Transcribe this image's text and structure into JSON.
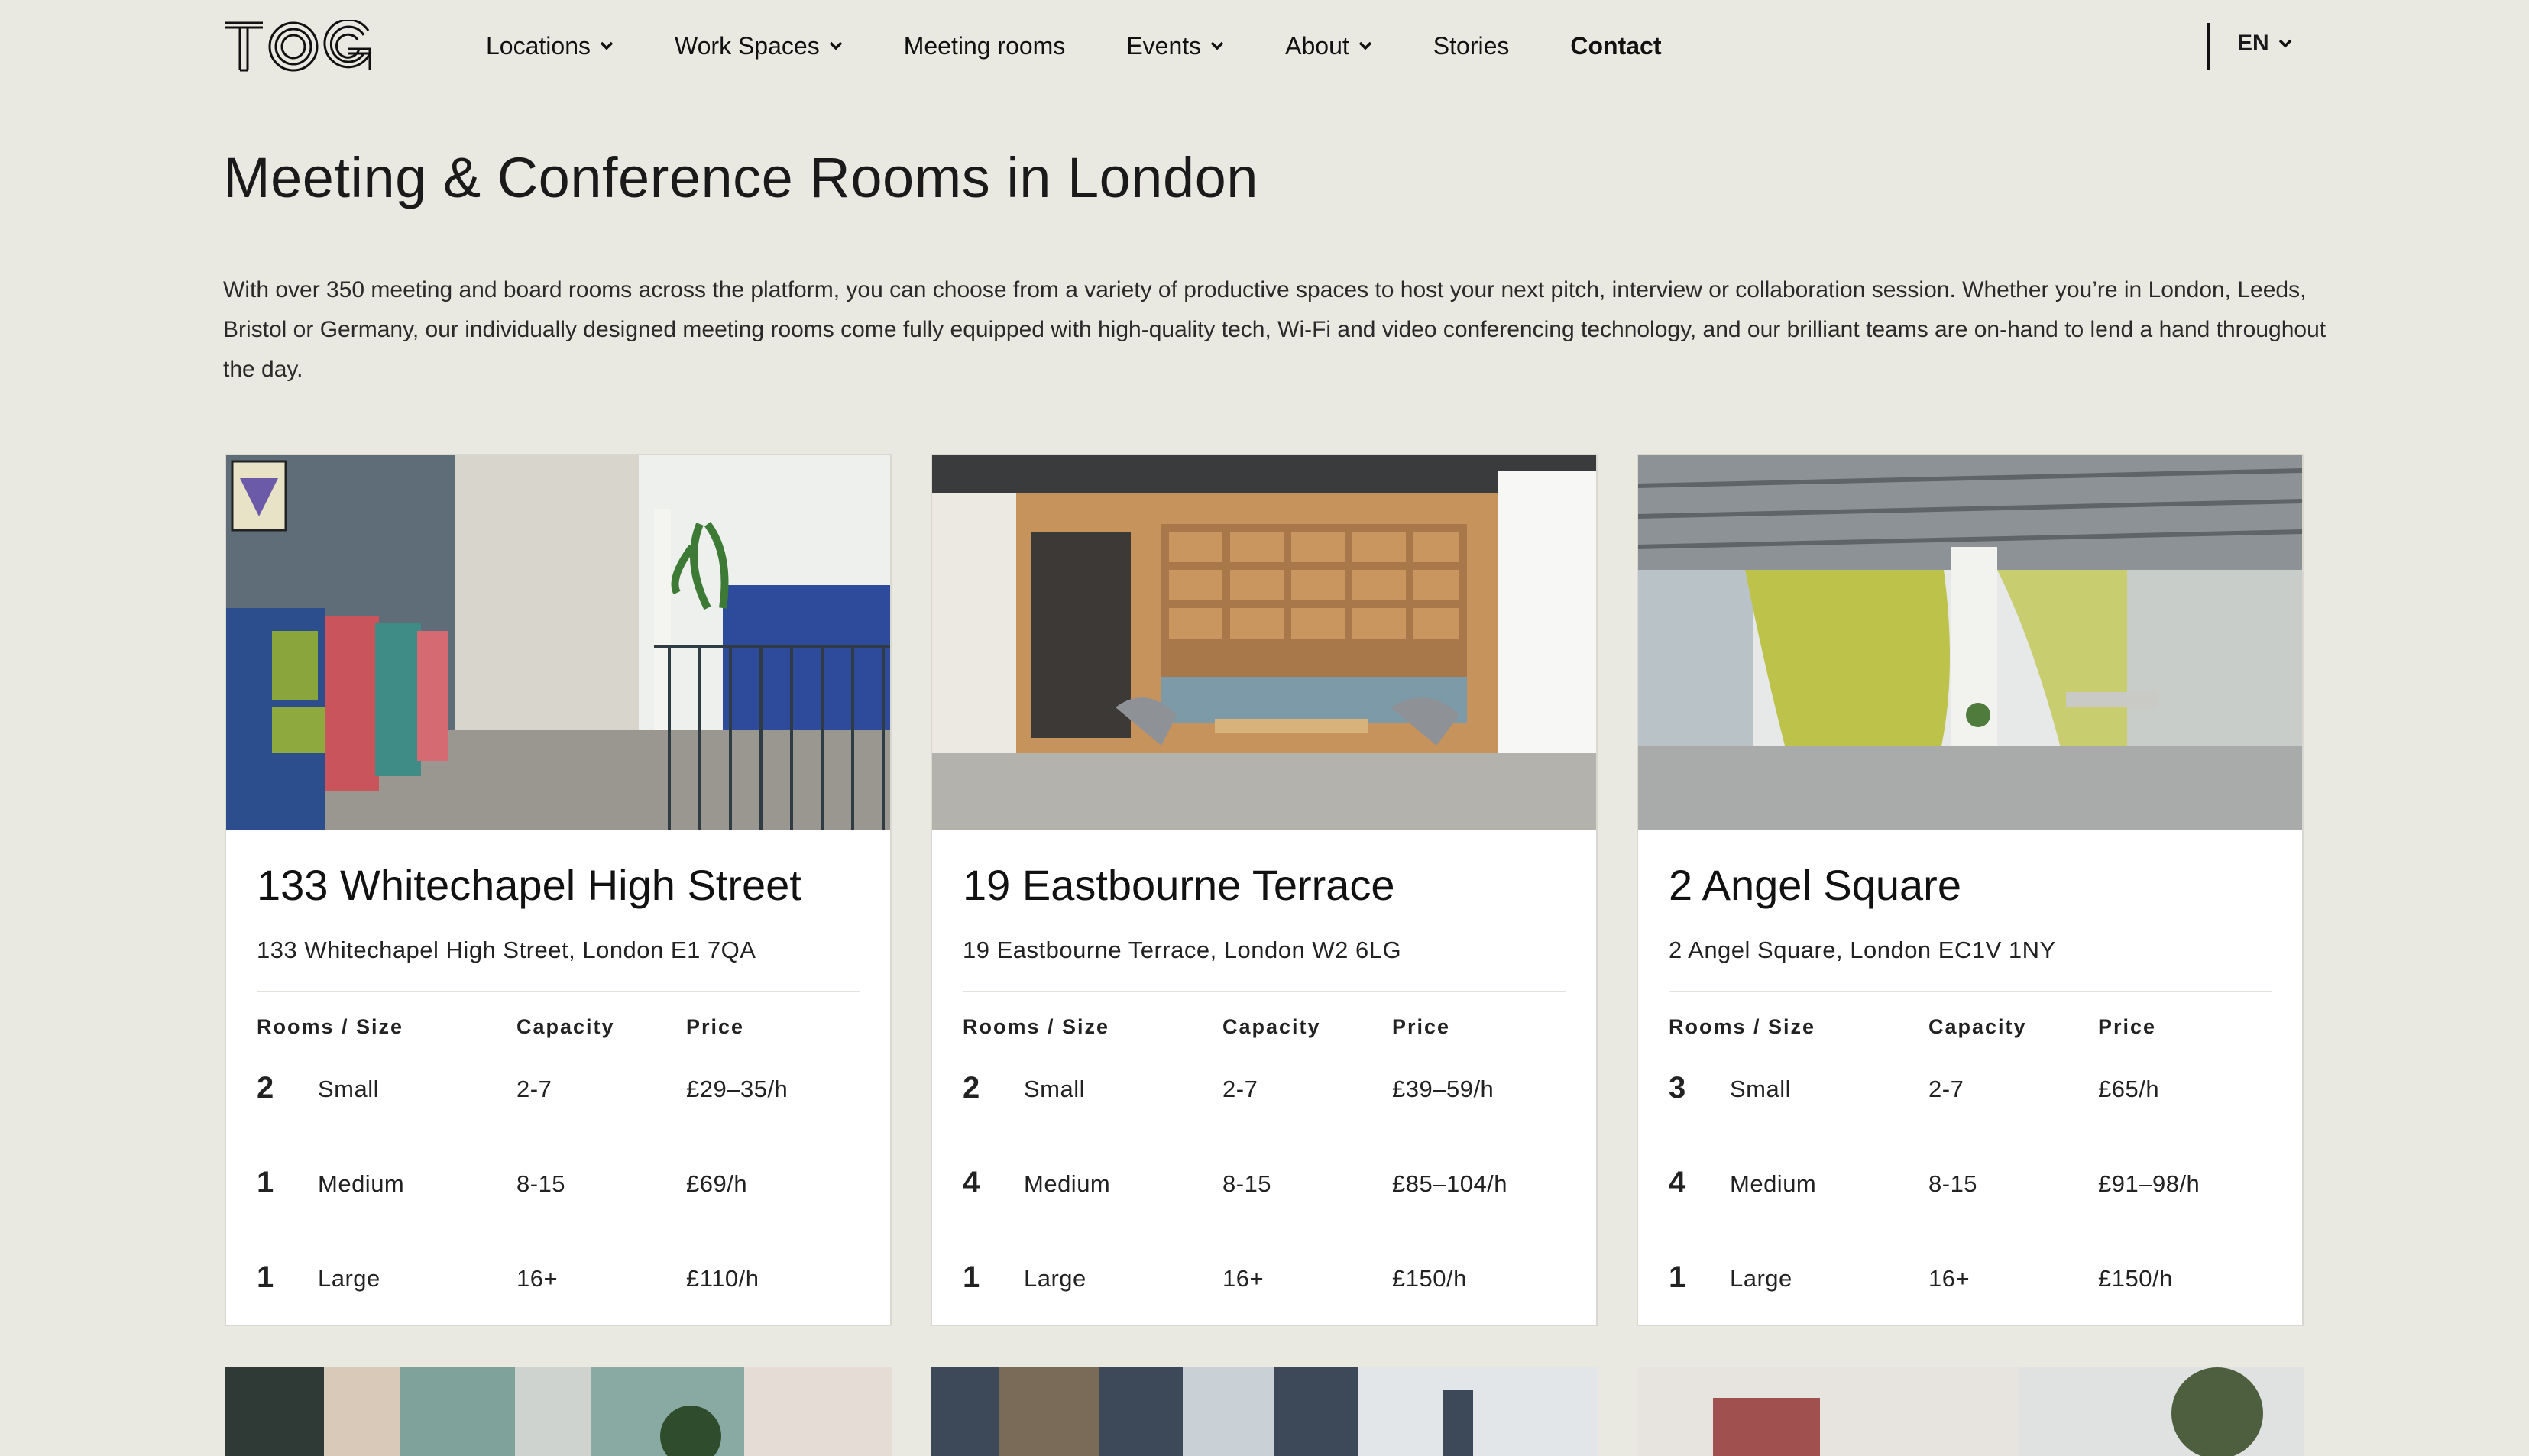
{
  "nav": {
    "logo_text": "TOG",
    "items": [
      {
        "label": "Locations",
        "dropdown": true
      },
      {
        "label": "Work Spaces",
        "dropdown": true
      },
      {
        "label": "Meeting rooms",
        "dropdown": false
      },
      {
        "label": "Events",
        "dropdown": true
      },
      {
        "label": "About",
        "dropdown": true
      },
      {
        "label": "Stories",
        "dropdown": false
      },
      {
        "label": "Contact",
        "dropdown": false
      }
    ],
    "language": "EN"
  },
  "page": {
    "title": "Meeting & Conference Rooms in London",
    "intro": "With over 350 meeting and board rooms across the platform, you can choose from a variety of productive spaces to host your next pitch, interview or collaboration session. Whether you’re in London, Leeds, Bristol or Germany, our individually designed meeting rooms come fully equipped with high-quality tech, Wi-Fi and video conferencing technology, and our brilliant teams are on-hand to lend a hand throughout the day."
  },
  "table_headers": {
    "rooms_size": "Rooms / Size",
    "capacity": "Capacity",
    "price": "Price"
  },
  "cards": [
    {
      "title": "133 Whitechapel High Street",
      "address": "133 Whitechapel High Street, London E1 7QA",
      "rows": [
        {
          "count": "2",
          "size": "Small",
          "capacity": "2-7",
          "price": "£29–35/h"
        },
        {
          "count": "1",
          "size": "Medium",
          "capacity": "8-15",
          "price": "£69/h"
        },
        {
          "count": "1",
          "size": "Large",
          "capacity": "16+",
          "price": "£110/h"
        }
      ]
    },
    {
      "title": "19 Eastbourne Terrace",
      "address": "19 Eastbourne Terrace, London W2 6LG",
      "rows": [
        {
          "count": "2",
          "size": "Small",
          "capacity": "2-7",
          "price": "£39–59/h"
        },
        {
          "count": "4",
          "size": "Medium",
          "capacity": "8-15",
          "price": "£85–104/h"
        },
        {
          "count": "1",
          "size": "Large",
          "capacity": "16+",
          "price": "£150/h"
        }
      ]
    },
    {
      "title": "2 Angel Square",
      "address": "2 Angel Square, London EC1V 1NY",
      "rows": [
        {
          "count": "3",
          "size": "Small",
          "capacity": "2-7",
          "price": "£65/h"
        },
        {
          "count": "4",
          "size": "Medium",
          "capacity": "8-15",
          "price": "£91–98/h"
        },
        {
          "count": "1",
          "size": "Large",
          "capacity": "16+",
          "price": "£150/h"
        }
      ]
    }
  ],
  "colors": {
    "background": "#e9e8e1",
    "card": "#ffffff",
    "text": "#111111"
  }
}
